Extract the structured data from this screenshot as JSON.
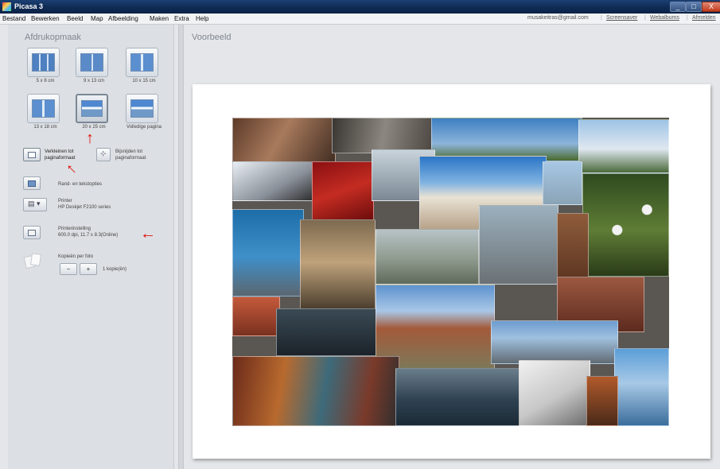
{
  "window": {
    "title": "Picasa 3",
    "min": "_",
    "max": "□",
    "close": "X"
  },
  "menu": [
    "Bestand",
    "Bewerken",
    "Beeld",
    "Map",
    "Afbeelding",
    "Maken",
    "Extra",
    "Help"
  ],
  "account": {
    "email": "musakeitras@gmail.com",
    "links": [
      "Screensaver",
      "Webalbums",
      "Afmelden"
    ]
  },
  "left_panel": {
    "heading": "Afdrukopmaak",
    "layouts": [
      {
        "label": "5 x 8 cm",
        "icon": "grid-layout-icon"
      },
      {
        "label": "9 x 13 cm",
        "icon": "grid-layout-icon"
      },
      {
        "label": "10 x 15 cm",
        "icon": "two-up-layout-icon"
      },
      {
        "label": "13 x 18 cm",
        "icon": "two-up-layout-icon"
      },
      {
        "label": "20 x 25 cm",
        "icon": "landscape-layout-icon",
        "selected": true
      },
      {
        "label": "Volledige pagina",
        "icon": "landscape-layout-icon"
      }
    ],
    "fit_option": {
      "line1": "Verkleinen tot",
      "line2": "paginaformaat",
      "active": true
    },
    "crop_option": {
      "line1": "Bijsnijden tot",
      "line2": "paginaformaat"
    },
    "border_option": {
      "label": "Rand- en tekstopties"
    },
    "printer": {
      "title": "Printer",
      "name": "HP Deskjet F2100 series"
    },
    "printer_setting": {
      "title": "Printerinstelling",
      "value": "600.0 dpi, 11.7 x 8.3(Online)"
    },
    "copies": {
      "title": "Kopieën per foto",
      "minus": "−",
      "plus": "+",
      "value": "1 kopie(ën)"
    }
  },
  "preview": {
    "heading": "Voorbeeld"
  },
  "annotations": {
    "arrow": "←",
    "arrow_up": "↑"
  },
  "colors": {
    "arrow": "#e0120b",
    "titlebar": "#0f2b54",
    "panel": "#dcdfe3"
  }
}
